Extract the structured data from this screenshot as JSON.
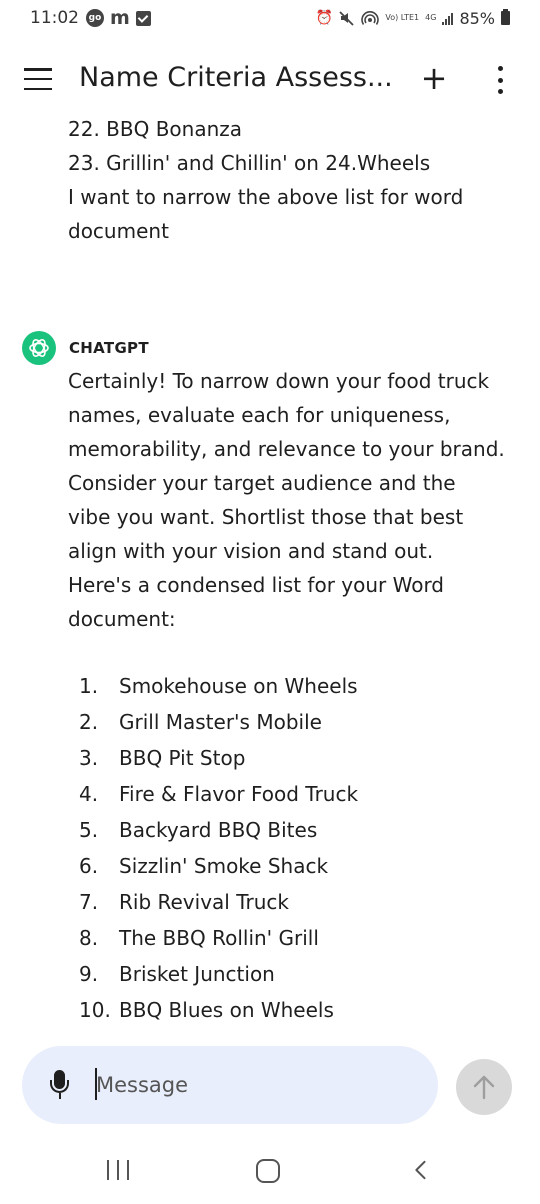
{
  "status_bar": {
    "time": "11:02",
    "go_badge": "go",
    "m_icon": "m",
    "network": "4G",
    "volte": "Vo) LTE1",
    "battery_percent": "85%",
    "icons": [
      "alarm-icon",
      "mute-icon",
      "hotspot-icon",
      "signal-icon",
      "battery-icon"
    ]
  },
  "header": {
    "title": "Name Criteria Assess...",
    "plus_label": "+",
    "icons": [
      "hamburger-menu-icon",
      "plus-icon",
      "more-vert-icon"
    ]
  },
  "conversation": {
    "user_message_lines": [
      "22. BBQ Bonanza",
      "23. Grillin' and Chillin' on 24.Wheels",
      "I want to narrow the above list for word",
      "document"
    ],
    "assistant_name": "CHATGPT",
    "assistant_paragraph_lines": [
      "Certainly! To narrow down your food truck",
      "names, evaluate each for uniqueness,",
      "memorability, and relevance to your brand.",
      "Consider your target audience and the",
      "vibe you want. Shortlist those that best",
      "align with your vision and stand out.",
      "Here's a condensed list for your Word",
      "document:"
    ],
    "list_items": [
      {
        "num": "1.",
        "text": "Smokehouse on Wheels"
      },
      {
        "num": "2.",
        "text": "Grill Master's Mobile"
      },
      {
        "num": "3.",
        "text": "BBQ Pit Stop"
      },
      {
        "num": "4.",
        "text": "Fire & Flavor Food Truck"
      },
      {
        "num": "5.",
        "text": "Backyard BBQ Bites"
      },
      {
        "num": "6.",
        "text": "Sizzlin' Smoke Shack"
      },
      {
        "num": "7.",
        "text": "Rib Revival Truck"
      },
      {
        "num": "8.",
        "text": "The BBQ Rollin' Grill"
      },
      {
        "num": "9.",
        "text": "Brisket Junction"
      },
      {
        "num": "10.",
        "text": "BBQ Blues on Wheels"
      }
    ]
  },
  "composer": {
    "placeholder": "Message",
    "value": "",
    "icons": [
      "microphone-icon",
      "send-arrow-icon"
    ]
  },
  "nav": {
    "icons": [
      "recents-icon",
      "home-icon",
      "back-icon"
    ]
  },
  "colors": {
    "accent_green": "#19c37d",
    "composer_bg": "#e8eefb",
    "send_button_bg": "#d9d9d9",
    "text": "#1f1f1f"
  }
}
